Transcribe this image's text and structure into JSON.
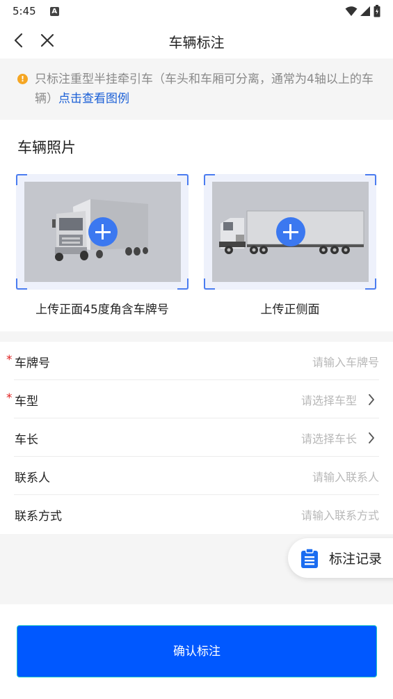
{
  "status_bar": {
    "time": "5:45",
    "notification_icon": "A"
  },
  "header": {
    "title": "车辆标注"
  },
  "notice": {
    "icon": "!",
    "text": "只标注重型半挂牵引车（车头和车厢可分离，通常为4轴以上的车辆）",
    "link": "点击查看图例"
  },
  "photos": {
    "title": "车辆照片",
    "front_label": "上传正面45度角含车牌号",
    "side_label": "上传正侧面"
  },
  "form": {
    "rows": [
      {
        "label": "车牌号",
        "placeholder": "请输入车牌号",
        "required": "*"
      },
      {
        "label": "车型",
        "placeholder": "请选择车型",
        "required": "*"
      },
      {
        "label": "车长",
        "placeholder": "请选择车长"
      },
      {
        "label": "联系人",
        "placeholder": "请输入联系人"
      },
      {
        "label": "联系方式",
        "placeholder": "请输入联系方式"
      }
    ]
  },
  "record_button": {
    "label": "标注记录"
  },
  "confirm_button": {
    "label": "确认标注"
  },
  "colors": {
    "primary": "#0058ff",
    "accent_blue": "#3b78f0",
    "warning": "#f5a623",
    "required": "#e02020"
  }
}
